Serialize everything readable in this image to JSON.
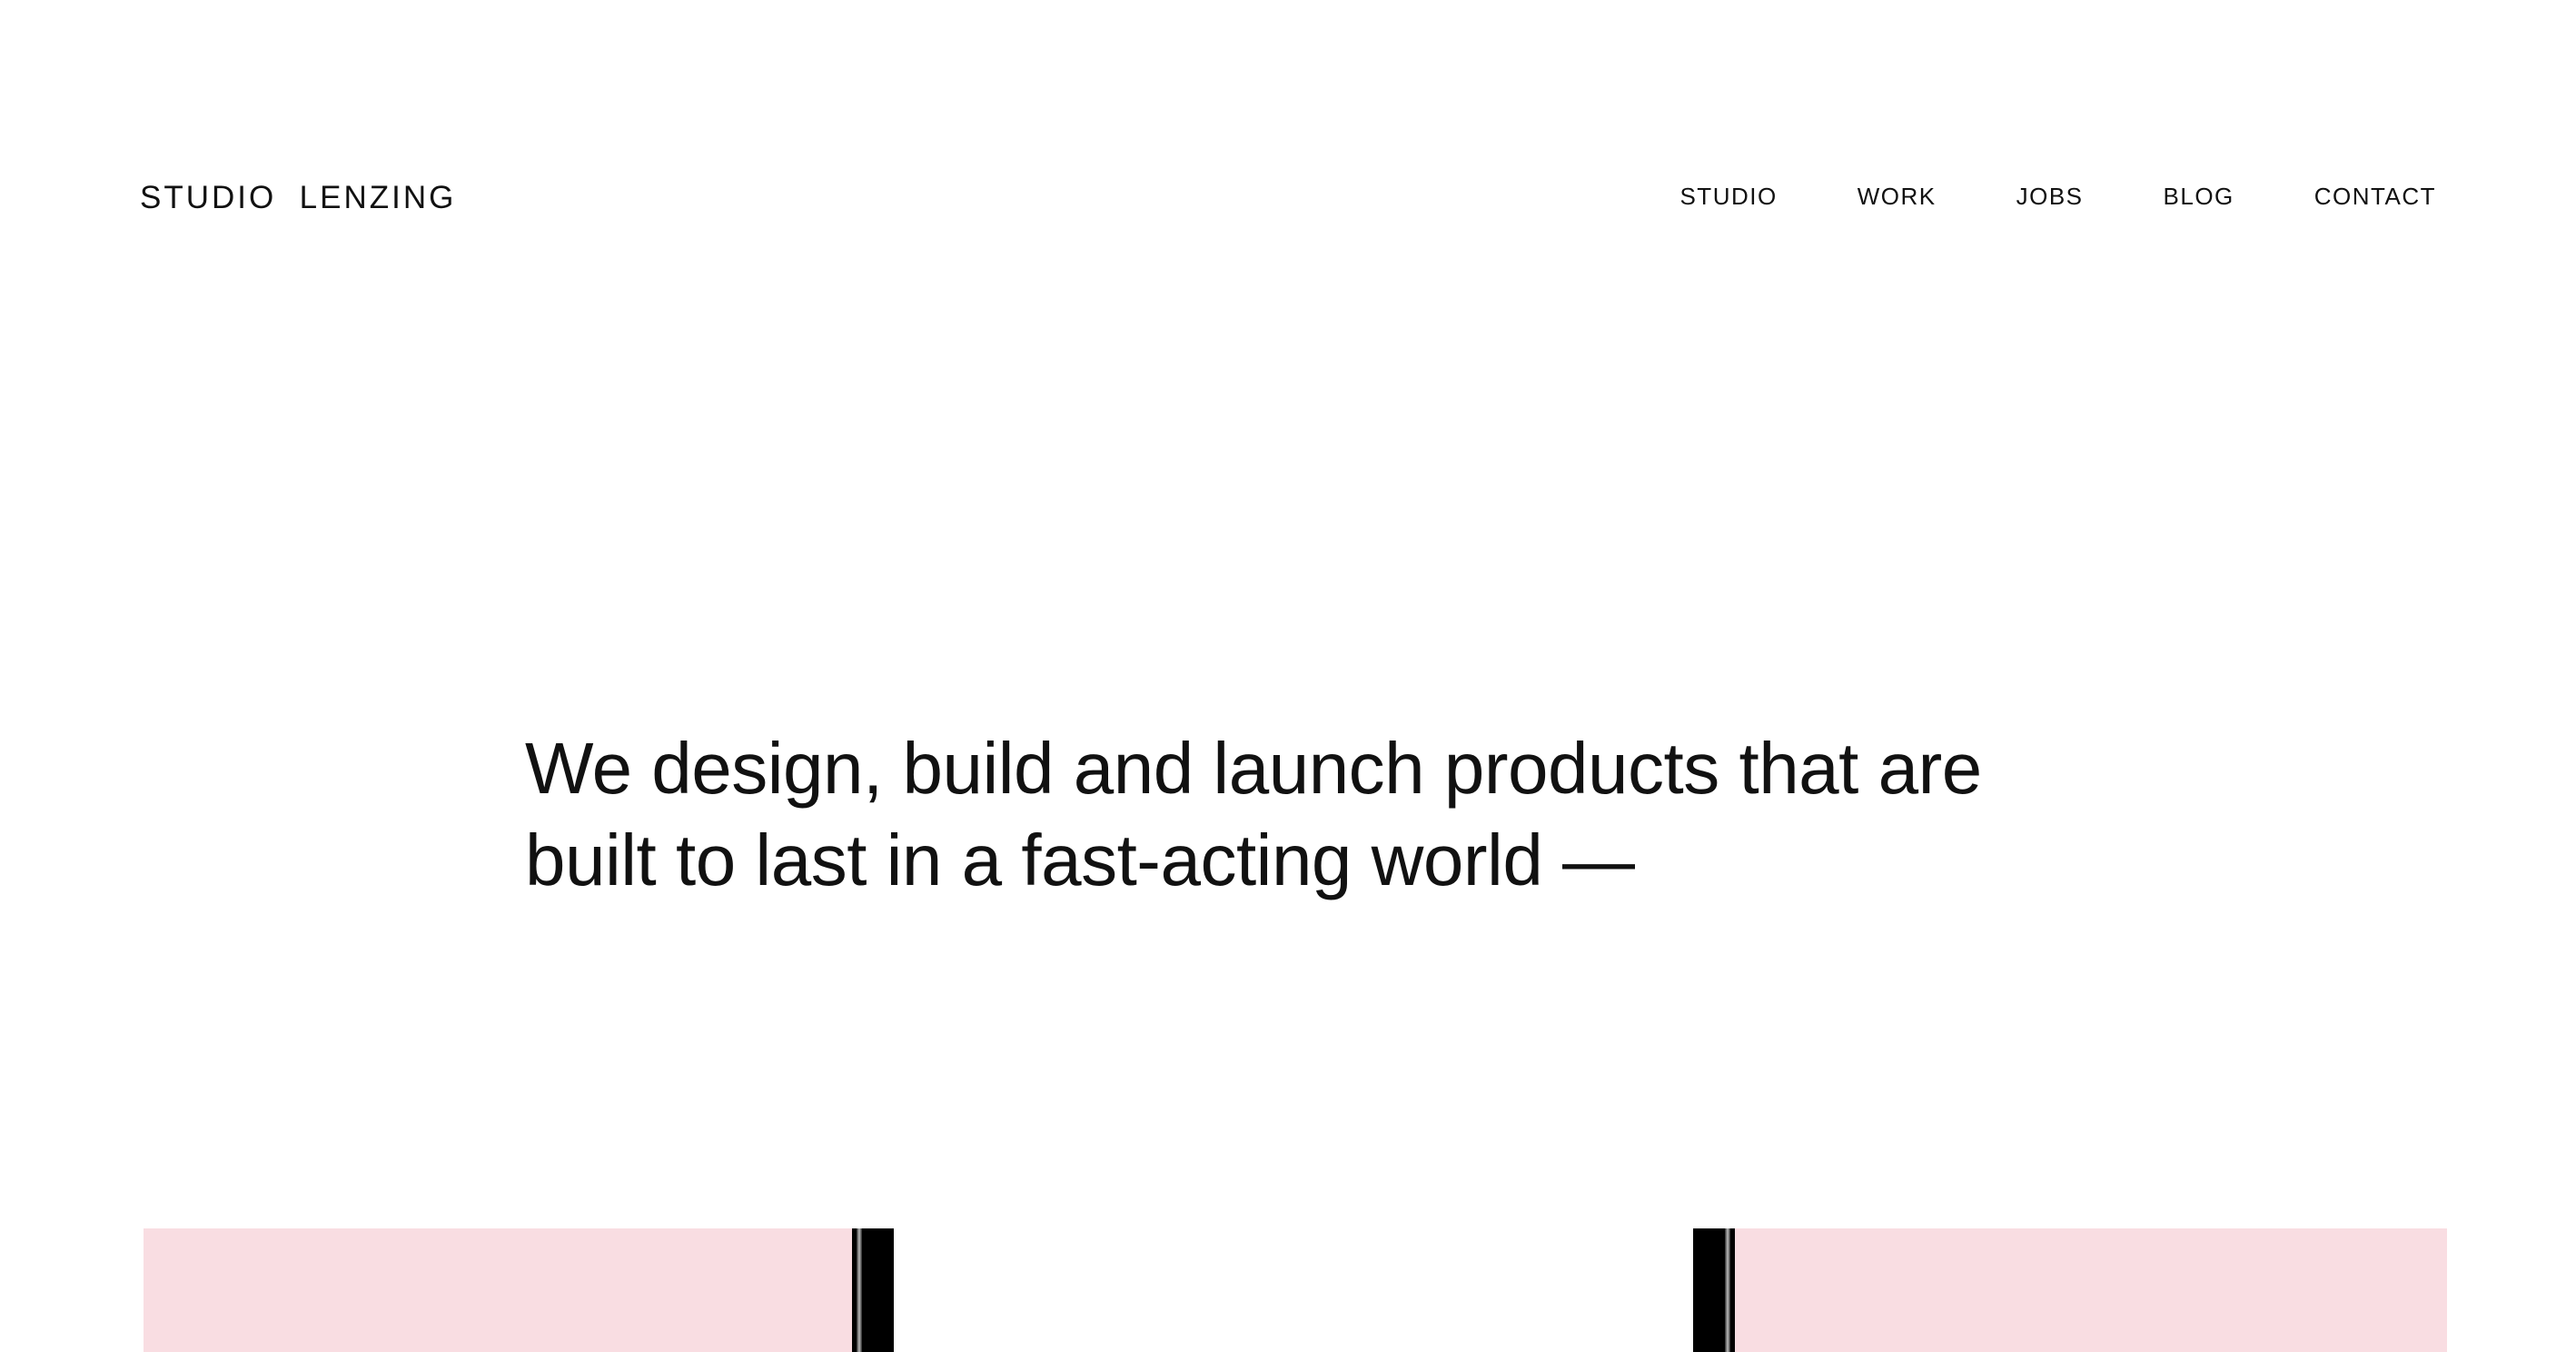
{
  "header": {
    "logo": "STUDIO  LENZING",
    "nav": [
      {
        "label": "STUDIO"
      },
      {
        "label": "WORK"
      },
      {
        "label": "JOBS"
      },
      {
        "label": "BLOG"
      },
      {
        "label": "CONTACT"
      }
    ]
  },
  "hero": {
    "line1": "We design, build and launch products that are",
    "line2": "built to last in a fast-acting world —"
  },
  "colors": {
    "background": "#ffffff",
    "text": "#111111",
    "panel_pink": "#f9dde2",
    "device_black": "#000000"
  }
}
